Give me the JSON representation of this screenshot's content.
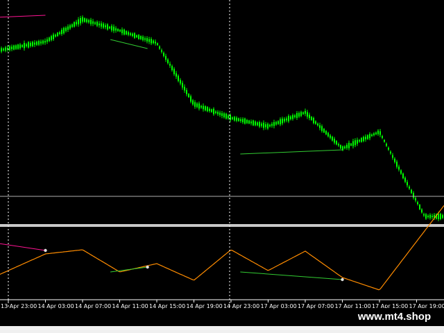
{
  "chart_data": {
    "type": "line",
    "title": "",
    "x": [
      "13 Apr 23:00",
      "14 Apr 03:00",
      "14 Apr 07:00",
      "14 Apr 11:00",
      "14 Apr 15:00",
      "14 Apr 19:00",
      "14 Apr 23:00",
      "17 Apr 03:00",
      "17 Apr 07:00",
      "17 Apr 11:00",
      "17 Apr 15:00",
      "17 Apr 19:00"
    ],
    "xlabel": "",
    "ylabel": "",
    "grid": false,
    "series": [
      {
        "values": [
          70,
          60,
          28,
          44,
          62,
          150,
          170,
          182,
          162,
          214,
          190,
          290
        ]
      },
      {
        "values": [
          390,
          366,
          360,
          392,
          380,
          404,
          360,
          390,
          362,
          400,
          418,
          348
        ]
      }
    ],
    "divergence_lines": [
      {
        "panel": "price",
        "color": "#ff1493",
        "from": [
          "13 Apr 20:00",
          26
        ],
        "to": [
          "14 Apr 03:00",
          22
        ]
      },
      {
        "panel": "price",
        "color": "#32cd32",
        "from": [
          "14 Apr 10:00",
          57
        ],
        "to": [
          "14 Apr 14:00",
          70
        ]
      },
      {
        "panel": "price",
        "color": "#32cd32",
        "from": [
          "17 Apr 00:00",
          222
        ],
        "to": [
          "17 Apr 11:00",
          216
        ]
      },
      {
        "panel": "indicator",
        "color": "#ff1493",
        "from": [
          "13 Apr 20:00",
          347
        ],
        "to": [
          "14 Apr 03:00",
          361
        ]
      },
      {
        "panel": "indicator",
        "color": "#32cd32",
        "from": [
          "14 Apr 10:00",
          392
        ],
        "to": [
          "14 Apr 14:00",
          385
        ]
      },
      {
        "panel": "indicator",
        "color": "#32cd32",
        "from": [
          "17 Apr 00:00",
          392
        ],
        "to": [
          "17 Apr 11:00",
          403
        ]
      }
    ],
    "colors": {
      "candles": "#00ff00",
      "indicator": "#ff8c00",
      "bearish_divergence": "#ff1493",
      "bullish_divergence": "#32cd32",
      "grid": "#c0c0c0"
    }
  },
  "watermark": "www.mt4.shop"
}
